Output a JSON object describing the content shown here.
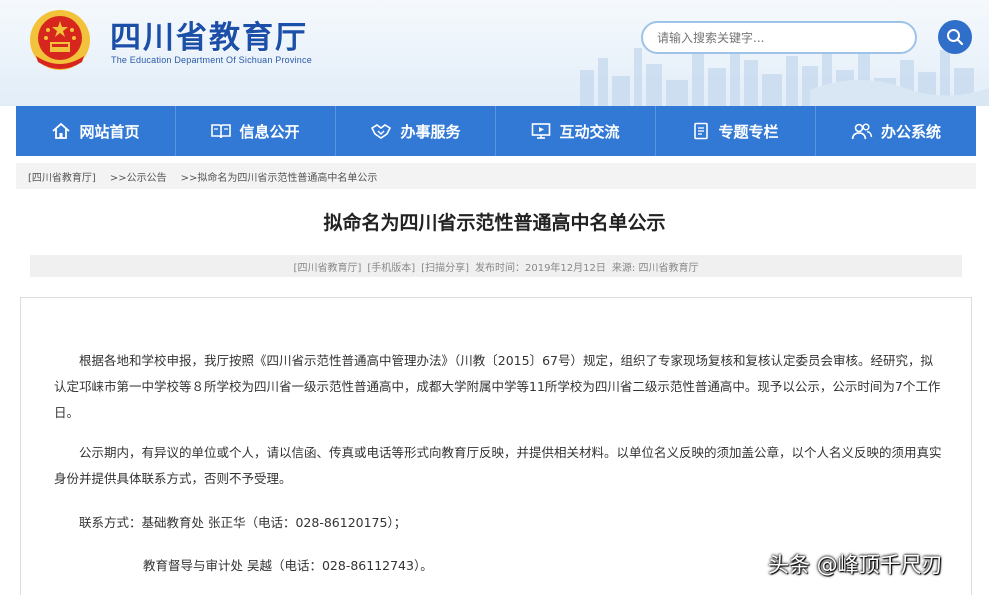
{
  "header": {
    "site_title": "四川省教育厅",
    "site_subtitle": "The Education Department Of Sichuan Province",
    "search_placeholder": "请输入搜索关键字..."
  },
  "nav": {
    "items": [
      {
        "label": "网站首页",
        "icon": "home-icon"
      },
      {
        "label": "信息公开",
        "icon": "book-icon"
      },
      {
        "label": "办事服务",
        "icon": "handshake-icon"
      },
      {
        "label": "互动交流",
        "icon": "monitor-icon"
      },
      {
        "label": "专题专栏",
        "icon": "document-icon"
      },
      {
        "label": "办公系统",
        "icon": "users-icon"
      }
    ]
  },
  "breadcrumb": {
    "items": [
      "[四川省教育厅]",
      ">>公示公告",
      ">>拟命名为四川省示范性普通高中名单公示"
    ]
  },
  "article": {
    "title": "拟命名为四川省示范性普通高中名单公示",
    "meta": {
      "source_link": "[四川省教育厅]",
      "mobile_link": "[手机版本]",
      "share_link": "[扫描分享]",
      "publish_time": "发布时间：2019年12月12日",
      "origin": "来源: 四川省教育厅"
    },
    "paragraphs": {
      "p1": "根据各地和学校申报，我厅按照《四川省示范性普通高中管理办法》（川教〔2015〕67号）规定，组织了专家现场复核和复核认定委员会审核。经研究，拟认定邛崃市第一中学校等８所学校为四川省一级示范性普通高中，成都大学附属中学等11所学校为四川省二级示范性普通高中。现予以公示，公示时间为7个工作日。",
      "p2": "公示期内，有异议的单位或个人，请以信函、传真或电话等形式向教育厅反映，并提供相关材料。以单位名义反映的须加盖公章，以个人名义反映的须用真实身份并提供具体联系方式，否则不予受理。",
      "p3": "联系方式：基础教育处 张正华（电话：028-86120175）；",
      "p4": "教育督导与审计处 吴越（电话：028-86112743）。"
    }
  },
  "watermark": "头条 @峰顶千尺刃",
  "colors": {
    "nav_bg": "#3279d6",
    "title_blue": "#1c4fa8",
    "emblem_red": "#d7261e",
    "emblem_gold": "#f2c23a"
  }
}
